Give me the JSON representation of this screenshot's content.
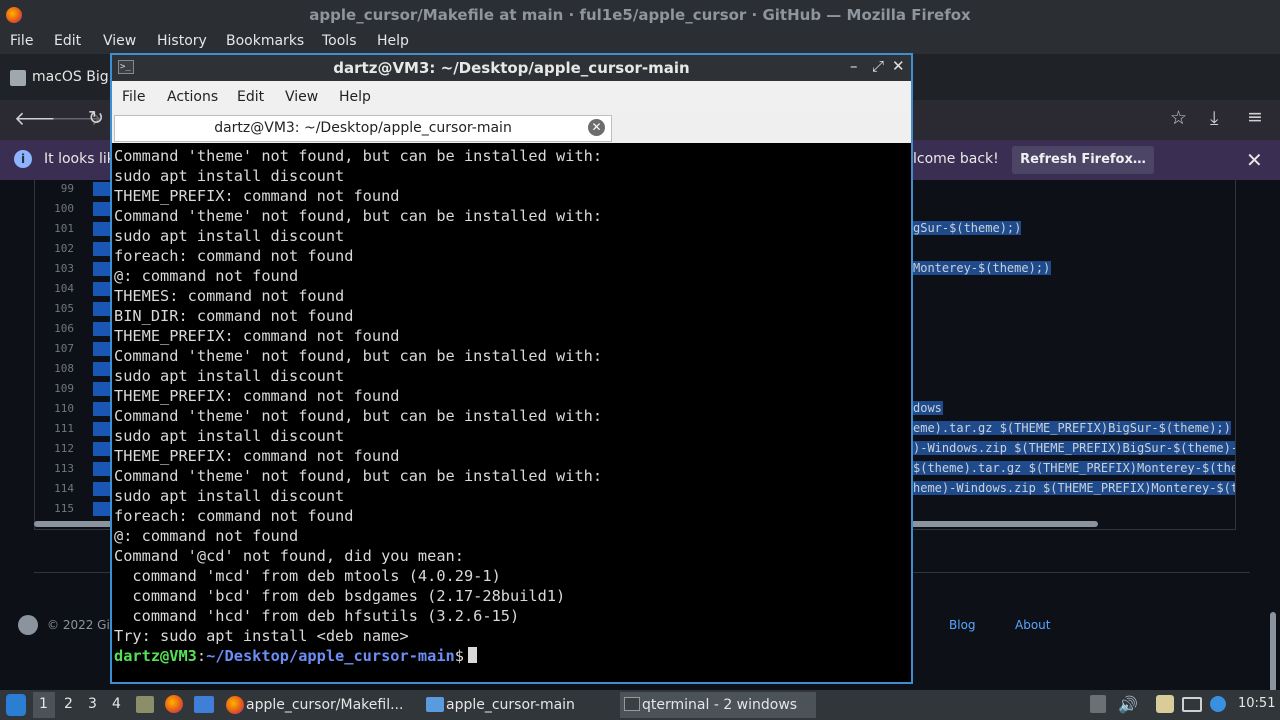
{
  "firefox": {
    "window_title": "apple_cursor/Makefile at main · ful1e5/apple_cursor · GitHub — Mozilla Firefox",
    "menu": [
      "File",
      "Edit",
      "View",
      "History",
      "Bookmarks",
      "Tools",
      "Help"
    ],
    "tab_title": "macOS Big",
    "notification": {
      "text_left": "It looks lik",
      "text_right": "lcome back!",
      "button": "Refresh Firefox…",
      "info_icon": "i",
      "close_icon": "✕"
    },
    "icons": {
      "back": "🡐",
      "forward": "🡒",
      "reload": "↻",
      "star": "☆",
      "download": "⤓",
      "menu": "≡"
    }
  },
  "github": {
    "line_numbers": [
      "99",
      "100",
      "101",
      "102",
      "103",
      "104",
      "105",
      "106",
      "107",
      "108",
      "109",
      "110",
      "111",
      "112",
      "113",
      "114",
      "115"
    ],
    "code_fragments": [
      {
        "line": "101",
        "text": "gSur-$(theme);)"
      },
      {
        "line": "103",
        "text": "Monterey-$(theme);)"
      },
      {
        "line": "110",
        "text": "dows"
      },
      {
        "line": "111",
        "text": "eme).tar.gz $(THEME_PREFIX)BigSur-$(theme);)"
      },
      {
        "line": "112",
        "text": ")-Windows.zip $(THEME_PREFIX)BigSur-$(theme)-"
      },
      {
        "line": "113",
        "text": "$(theme).tar.gz $(THEME_PREFIX)Monterey-$(the"
      },
      {
        "line": "114",
        "text": "heme)-Windows.zip $(THEME_PREFIX)Monterey-$(t"
      }
    ],
    "footer": {
      "copyright": "© 2022 GitH",
      "links": [
        "Blog",
        "About"
      ]
    }
  },
  "terminal": {
    "window_title": "dartz@VM3: ~/Desktop/apple_cursor-main",
    "menu": [
      "File",
      "Actions",
      "Edit",
      "View",
      "Help"
    ],
    "tab_title": "dartz@VM3: ~/Desktop/apple_cursor-main",
    "output_lines": [
      "Command 'theme' not found, but can be installed with:",
      "sudo apt install discount",
      "THEME_PREFIX: command not found",
      "Command 'theme' not found, but can be installed with:",
      "sudo apt install discount",
      "foreach: command not found",
      "@: command not found",
      "THEMES: command not found",
      "BIN_DIR: command not found",
      "THEME_PREFIX: command not found",
      "Command 'theme' not found, but can be installed with:",
      "sudo apt install discount",
      "THEME_PREFIX: command not found",
      "Command 'theme' not found, but can be installed with:",
      "sudo apt install discount",
      "THEME_PREFIX: command not found",
      "Command 'theme' not found, but can be installed with:",
      "sudo apt install discount",
      "foreach: command not found",
      "@: command not found",
      "Command '@cd' not found, did you mean:",
      "  command 'mcd' from deb mtools (4.0.29-1)",
      "  command 'bcd' from deb bsdgames (2.17-28build1)",
      "  command 'hcd' from deb hfsutils (3.2.6-15)",
      "Try: sudo apt install <deb name>"
    ],
    "prompt": {
      "user": "dartz@VM3",
      "sep": ":",
      "path": "~/Desktop/apple_cursor-main",
      "symbol": "$"
    }
  },
  "taskbar": {
    "workspaces": [
      "1",
      "2",
      "3",
      "4"
    ],
    "items": [
      "apple_cursor/Makefil...",
      "apple_cursor-main",
      "qterminal - 2 windows"
    ],
    "clock": "10:51"
  }
}
